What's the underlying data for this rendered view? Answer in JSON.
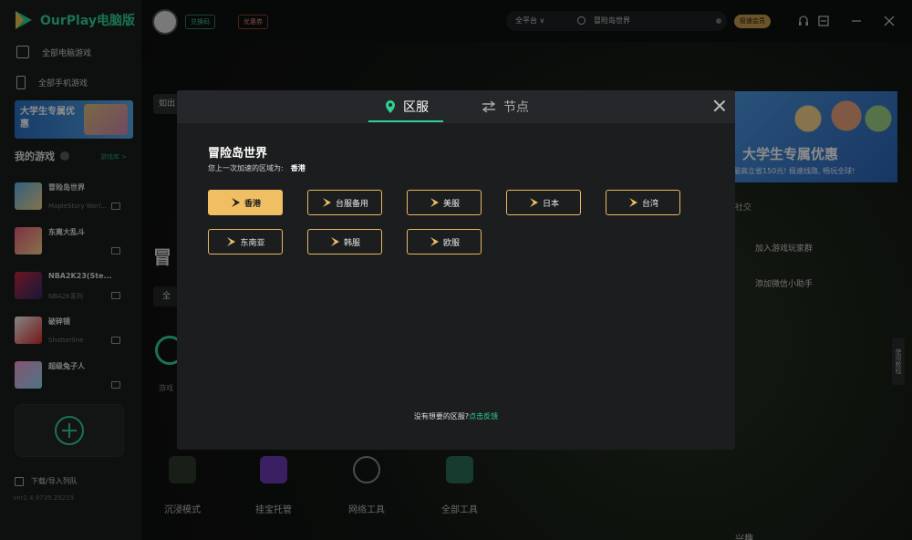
{
  "app": {
    "title": "OurPlay电脑版",
    "brand_color": "#2fd193"
  },
  "sidebar": {
    "nav": [
      {
        "label": "全部电脑游戏",
        "icon": "monitor-icon"
      },
      {
        "label": "全部手机游戏",
        "icon": "phone-icon"
      }
    ],
    "promo": {
      "text": "大学生专属优惠"
    },
    "my_games_title": "我的游戏",
    "library_link": "游戏库 >",
    "games": [
      {
        "name": "冒险岛世界",
        "sub": "MapleStory Worl..."
      },
      {
        "name": "东离大乱斗",
        "sub": ""
      },
      {
        "name": "NBA2K23(Ste...",
        "sub": "NBA2K系列"
      },
      {
        "name": "破碎镜",
        "sub": "Shatterline"
      },
      {
        "name": "超级兔子人",
        "sub": ""
      }
    ],
    "download_label": "下载/导入列队",
    "version": "ver2.4.9739.29219"
  },
  "topbar": {
    "code_chip": "兑换码",
    "coupon_chip": "优惠券",
    "platform": "全平台  ∨",
    "search_value": "冒险岛世界",
    "vip_label": "极速会员"
  },
  "background": {
    "left_tab": "如出",
    "big_title": "冒",
    "select": "全",
    "accel_label": "游戏",
    "banner_title": "大学生专属优惠",
    "banner_sub": "最高立省150元! 极速线路, 畅玩全球!",
    "social_tag": "社交",
    "side_links": [
      "加入游戏玩家群",
      "添加微信小助手"
    ],
    "float_tab": "使用教程",
    "tools": [
      "沉浸模式",
      "挂宝托管",
      "网络工具",
      "全部工具"
    ],
    "bottom_fragment": "兴趣 ..."
  },
  "modal": {
    "tabs": [
      {
        "label": "区服",
        "icon": "location-pin-icon",
        "active": true
      },
      {
        "label": "节点",
        "icon": "swap-arrows-icon",
        "active": false
      }
    ],
    "game_title": "冒险岛世界",
    "last_region_label": "您上一次加速的区域为:",
    "last_region_value": "香港",
    "regions": [
      {
        "label": "香港",
        "selected": true
      },
      {
        "label": "台服备用",
        "selected": false
      },
      {
        "label": "美服",
        "selected": false
      },
      {
        "label": "日本",
        "selected": false
      },
      {
        "label": "台湾",
        "selected": false
      },
      {
        "label": "东南亚",
        "selected": false
      },
      {
        "label": "韩服",
        "selected": false
      },
      {
        "label": "欧服",
        "selected": false
      }
    ],
    "feedback_text": "没有想要的区服?",
    "feedback_link": "点击反馈",
    "accent_color": "#f0bf63"
  }
}
